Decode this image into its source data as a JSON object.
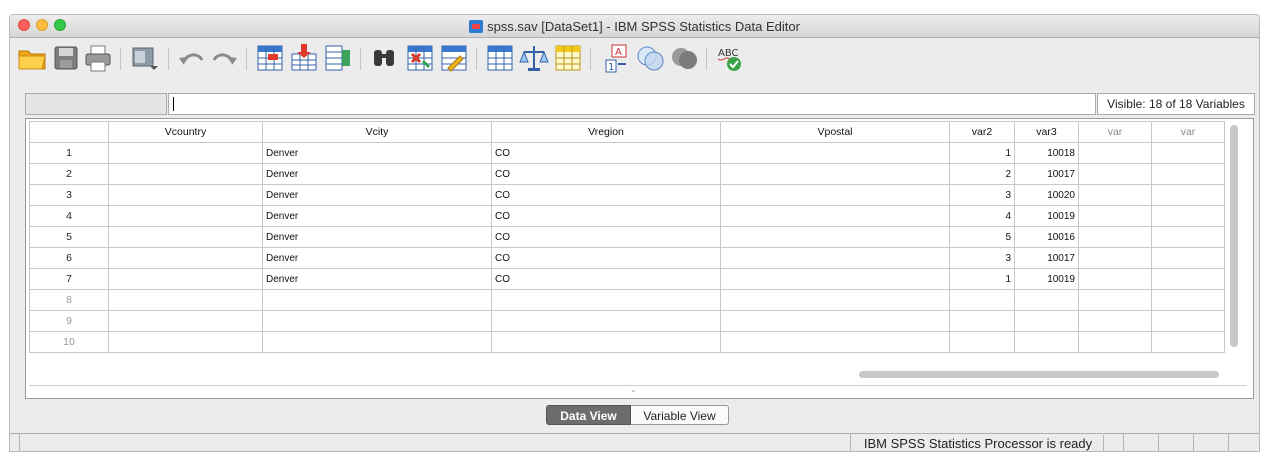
{
  "window": {
    "title": "spss.sav [DataSet1] - IBM SPSS Statistics Data Editor"
  },
  "toolbar": {
    "icons": [
      "open-folder-icon",
      "save-icon",
      "print-icon",
      "dialog-recall-icon",
      "undo-icon",
      "redo-icon",
      "goto-case-icon",
      "goto-variable-icon",
      "variables-icon",
      "find-icon",
      "insert-cases-icon",
      "insert-variable-icon",
      "split-file-icon",
      "weight-cases-icon",
      "select-cases-icon",
      "value-labels-icon",
      "use-sets-icon",
      "show-all-variables-icon",
      "spell-check-icon"
    ]
  },
  "cellbar": {
    "name_value": "",
    "cell_value": "",
    "visible_label": "Visible: 18 of 18 Variables"
  },
  "grid": {
    "columns": [
      "Vcountry",
      "Vcity",
      "Vregion",
      "Vpostal",
      "var2",
      "var3",
      "var",
      "var"
    ],
    "rows": [
      {
        "n": "1",
        "Vcountry": "",
        "Vcity": "Denver",
        "Vregion": "CO",
        "Vpostal": "",
        "var2": "1",
        "var3": "10018"
      },
      {
        "n": "2",
        "Vcountry": "",
        "Vcity": "Denver",
        "Vregion": "CO",
        "Vpostal": "",
        "var2": "2",
        "var3": "10017"
      },
      {
        "n": "3",
        "Vcountry": "",
        "Vcity": "Denver",
        "Vregion": "CO",
        "Vpostal": "",
        "var2": "3",
        "var3": "10020"
      },
      {
        "n": "4",
        "Vcountry": "",
        "Vcity": "Denver",
        "Vregion": "CO",
        "Vpostal": "",
        "var2": "4",
        "var3": "10019"
      },
      {
        "n": "5",
        "Vcountry": "",
        "Vcity": "Denver",
        "Vregion": "CO",
        "Vpostal": "",
        "var2": "5",
        "var3": "10016"
      },
      {
        "n": "6",
        "Vcountry": "",
        "Vcity": "Denver",
        "Vregion": "CO",
        "Vpostal": "",
        "var2": "3",
        "var3": "10017"
      },
      {
        "n": "7",
        "Vcountry": "",
        "Vcity": "Denver",
        "Vregion": "CO",
        "Vpostal": "",
        "var2": "1",
        "var3": "10019"
      },
      {
        "n": "8",
        "Vcountry": "",
        "Vcity": "",
        "Vregion": "",
        "Vpostal": "",
        "var2": "",
        "var3": ""
      },
      {
        "n": "9",
        "Vcountry": "",
        "Vcity": "",
        "Vregion": "",
        "Vpostal": "",
        "var2": "",
        "var3": ""
      },
      {
        "n": "10",
        "Vcountry": "",
        "Vcity": "",
        "Vregion": "",
        "Vpostal": "",
        "var2": "",
        "var3": ""
      }
    ]
  },
  "tabs": {
    "data_view": "Data View",
    "variable_view": "Variable View"
  },
  "status": {
    "text": "IBM SPSS Statistics Processor is ready"
  }
}
